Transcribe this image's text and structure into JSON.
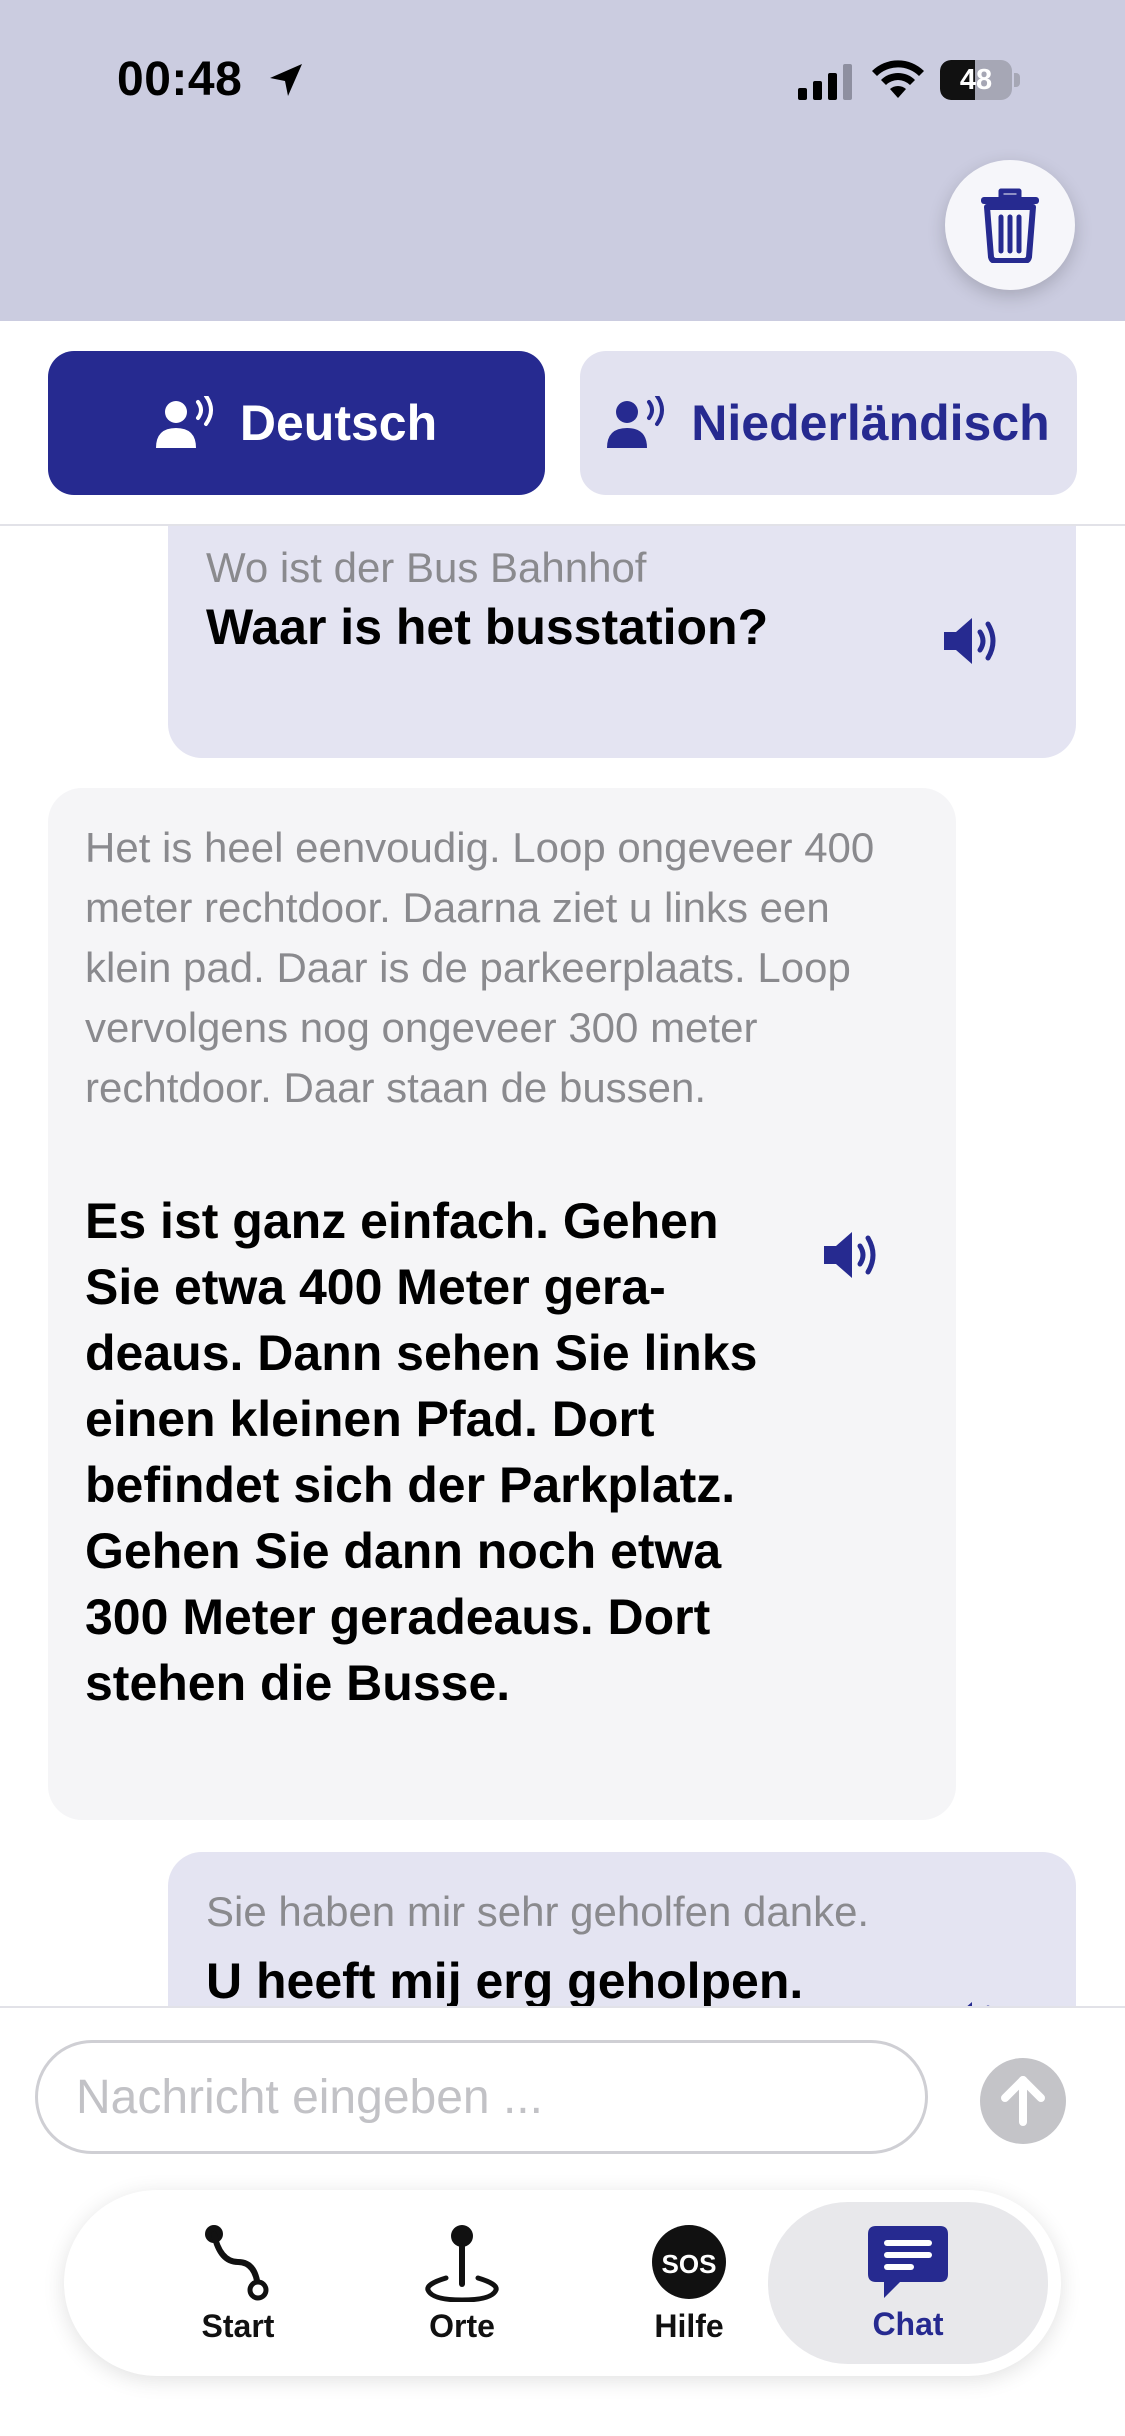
{
  "status_bar": {
    "time": "00:48",
    "battery_percent": "48",
    "battery_level": 0.48
  },
  "header": {
    "trash_icon": "trash-icon"
  },
  "languages": {
    "source": {
      "label": "Deutsch",
      "icon": "speaker-person-icon"
    },
    "target": {
      "label": "Niederländisch",
      "icon": "speaker-person-icon"
    }
  },
  "messages": [
    {
      "side": "right",
      "original": "Wo ist der Bus Bahnhof",
      "translation": "Waar is het busstation?"
    },
    {
      "side": "left",
      "original": "Het is heel eenvoudig. Loop ongeveer 400 meter rechtdoor. Daarna ziet u links een klein pad. Daar is de parkeerplaats. Loop vervolgens nog ongeveer 300 meter rechtdoor. Daar staan de bussen.",
      "translation": "Es ist ganz einfach. Gehen Sie etwa 400 Meter gera-deaus. Dann sehen Sie links einen kleinen Pfad. Dort befindet sich der Parkplatz. Gehen Sie dann noch etwa 300 Meter geradeaus. Dort stehen die Busse."
    },
    {
      "side": "right",
      "original": "Sie haben mir sehr geholfen danke.",
      "translation": "U heeft mij erg geholpen."
    }
  ],
  "composer": {
    "placeholder": "Nachricht eingeben ..."
  },
  "tabs": [
    {
      "label": "Start",
      "icon": "route-icon"
    },
    {
      "label": "Orte",
      "icon": "map-pin-icon"
    },
    {
      "label": "Hilfe",
      "icon": "sos-icon",
      "icon_text": "SOS"
    },
    {
      "label": "Chat",
      "icon": "chat-icon",
      "active": true
    }
  ],
  "colors": {
    "accent": "#262a90",
    "header_bg": "#cbcce0",
    "bubble_right": "#e4e4f2",
    "bubble_left": "#f5f5f7"
  }
}
